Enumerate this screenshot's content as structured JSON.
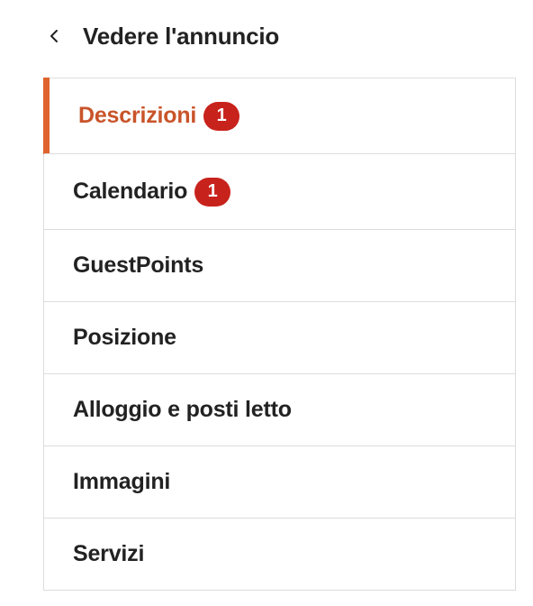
{
  "header": {
    "back_icon": "chevron-left-icon",
    "back_label": "Vedere l'annuncio"
  },
  "menu": {
    "accent_color": "#e0622c",
    "badge_color": "#c8221c",
    "items": [
      {
        "label": "Descrizioni",
        "badge": "1",
        "active": true
      },
      {
        "label": "Calendario",
        "badge": "1",
        "active": false
      },
      {
        "label": "GuestPoints",
        "active": false
      },
      {
        "label": "Posizione",
        "active": false
      },
      {
        "label": "Alloggio e posti letto",
        "active": false
      },
      {
        "label": "Immagini",
        "active": false
      },
      {
        "label": "Servizi",
        "active": false
      }
    ]
  }
}
